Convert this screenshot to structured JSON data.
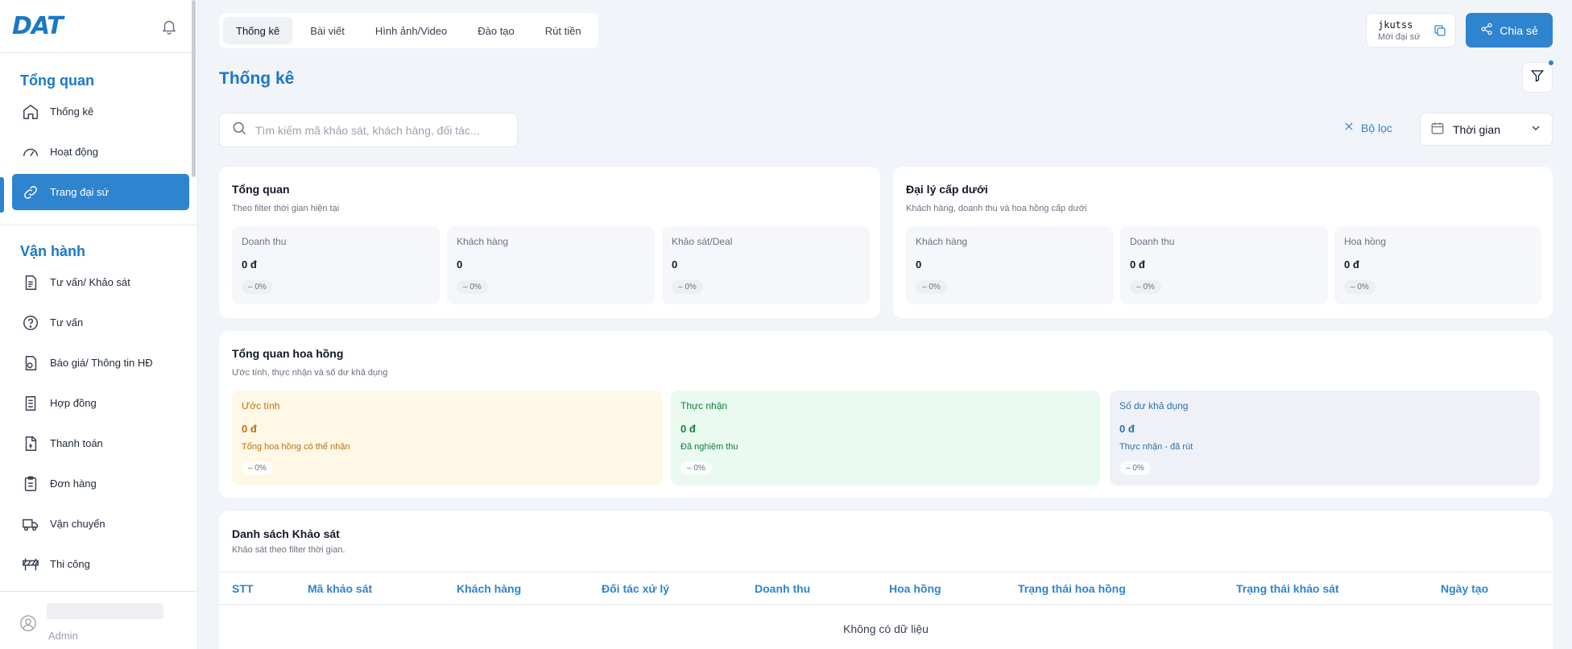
{
  "brand": {
    "logo": "DAT"
  },
  "sidebar": {
    "sections": [
      {
        "title": "Tổng quan",
        "items": [
          {
            "label": "Thống kê",
            "icon": "home-icon"
          },
          {
            "label": "Hoạt động",
            "icon": "gauge-icon"
          },
          {
            "label": "Trang đại sứ",
            "icon": "link-icon",
            "active": true
          }
        ]
      },
      {
        "title": "Vận hành",
        "items": [
          {
            "label": "Tư vấn/ Khảo sát",
            "icon": "document-list-icon"
          },
          {
            "label": "Tư vấn",
            "icon": "help-circle-icon"
          },
          {
            "label": "Báo giá/ Thông tin HĐ",
            "icon": "file-quote-icon"
          },
          {
            "label": "Hợp đồng",
            "icon": "contract-icon"
          },
          {
            "label": "Thanh toán",
            "icon": "payment-icon"
          },
          {
            "label": "Đơn hàng",
            "icon": "clipboard-icon"
          },
          {
            "label": "Vận chuyển",
            "icon": "truck-icon"
          },
          {
            "label": "Thi công",
            "icon": "construction-icon"
          }
        ]
      }
    ],
    "user": {
      "role": "Admin"
    }
  },
  "topbar": {
    "tabs": [
      "Thống kê",
      "Bài viết",
      "Hình ảnh/Video",
      "Đào tạo",
      "Rút tiền"
    ],
    "active_tab": 0,
    "referral": {
      "code": "jkutss",
      "label": "Mời đại sứ"
    },
    "share_label": "Chia sẻ"
  },
  "page": {
    "title": "Thống kê"
  },
  "filters": {
    "search_placeholder": "Tìm kiếm mã khảo sát, khách hàng, đối tác...",
    "reset_label": "Bộ lọc",
    "time_label": "Thời gian"
  },
  "overview": {
    "title": "Tổng quan",
    "subtitle": "Theo filter thời gian hiện tại",
    "stats": [
      {
        "label": "Doanh thu",
        "value": "0 đ",
        "change": "– 0%"
      },
      {
        "label": "Khách hàng",
        "value": "0",
        "change": "– 0%"
      },
      {
        "label": "Khảo sát/Deal",
        "value": "0",
        "change": "– 0%"
      }
    ]
  },
  "sub_agents": {
    "title": "Đại lý cấp dưới",
    "subtitle": "Khách hàng, doanh thu và hoa hồng cấp dưới",
    "stats": [
      {
        "label": "Khách hàng",
        "value": "0",
        "change": "– 0%"
      },
      {
        "label": "Doanh thu",
        "value": "0 đ",
        "change": "– 0%"
      },
      {
        "label": "Hoa hồng",
        "value": "0 đ",
        "change": "– 0%"
      }
    ]
  },
  "commission": {
    "title": "Tổng quan hoa hồng",
    "subtitle": "Ước tính, thực nhận và số dư khả dụng",
    "stats": [
      {
        "label": "Ước tính",
        "value": "0 đ",
        "note": "Tổng hoa hồng có thể nhận",
        "change": "– 0%",
        "bg": "#fff8e7",
        "color": "#c2700c"
      },
      {
        "label": "Thực nhận",
        "value": "0 đ",
        "note": "Đã nghiệm thu",
        "change": "– 0%",
        "bg": "#eafaf1",
        "color": "#15803d"
      },
      {
        "label": "Số dư khả dụng",
        "value": "0 đ",
        "note": "Thực nhận - đã rút",
        "change": "– 0%",
        "bg": "#eef1f7",
        "color": "#2f6fa8"
      }
    ]
  },
  "survey_list": {
    "title": "Danh sách Khảo sát",
    "subtitle": "Khảo sát theo filter thời gian.",
    "columns": [
      "STT",
      "Mã khảo sát",
      "Khách hàng",
      "Đối tác xử lý",
      "Doanh thu",
      "Hoa hồng",
      "Trạng thái hoa hồng",
      "Trạng thái khảo sát",
      "Ngày tạo"
    ],
    "empty_text": "Không có dữ liệu"
  },
  "colors": {
    "accent": "#2f84cf",
    "title": "#1a78c9"
  }
}
